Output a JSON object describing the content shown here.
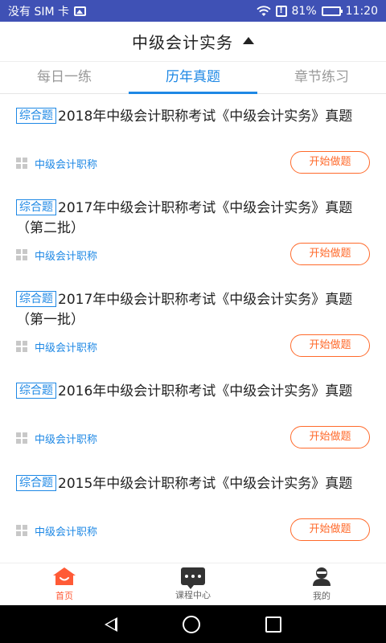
{
  "status": {
    "carrier": "没有 SIM 卡",
    "battery_pct": "81%",
    "time": "11:20",
    "battery_level": 0.81
  },
  "header": {
    "title": "中级会计实务"
  },
  "tabs": [
    {
      "label": "每日一练",
      "active": false
    },
    {
      "label": "历年真题",
      "active": true
    },
    {
      "label": "章节练习",
      "active": false
    }
  ],
  "items": [
    {
      "badge": "综合题",
      "title": "2018年中级会计职称考试《中级会计实务》真题",
      "category": "中级会计职称",
      "button": "开始做题"
    },
    {
      "badge": "综合题",
      "title": "2017年中级会计职称考试《中级会计实务》真题（第二批）",
      "category": "中级会计职称",
      "button": "开始做题"
    },
    {
      "badge": "综合题",
      "title": "2017年中级会计职称考试《中级会计实务》真题（第一批）",
      "category": "中级会计职称",
      "button": "开始做题"
    },
    {
      "badge": "综合题",
      "title": "2016年中级会计职称考试《中级会计实务》真题",
      "category": "中级会计职称",
      "button": "开始做题"
    },
    {
      "badge": "综合题",
      "title": "2015年中级会计职称考试《中级会计实务》真题",
      "category": "中级会计职称",
      "button": "开始做题"
    }
  ],
  "bottom_nav": [
    {
      "label": "首页",
      "icon": "home-icon",
      "active": true
    },
    {
      "label": "课程中心",
      "icon": "chat-icon",
      "active": false
    },
    {
      "label": "我的",
      "icon": "user-icon",
      "active": false
    }
  ],
  "colors": {
    "accent": "#1e88e5",
    "action": "#ff6a2b",
    "statusbar": "#3f51b5",
    "home_active": "#ff5a36"
  }
}
